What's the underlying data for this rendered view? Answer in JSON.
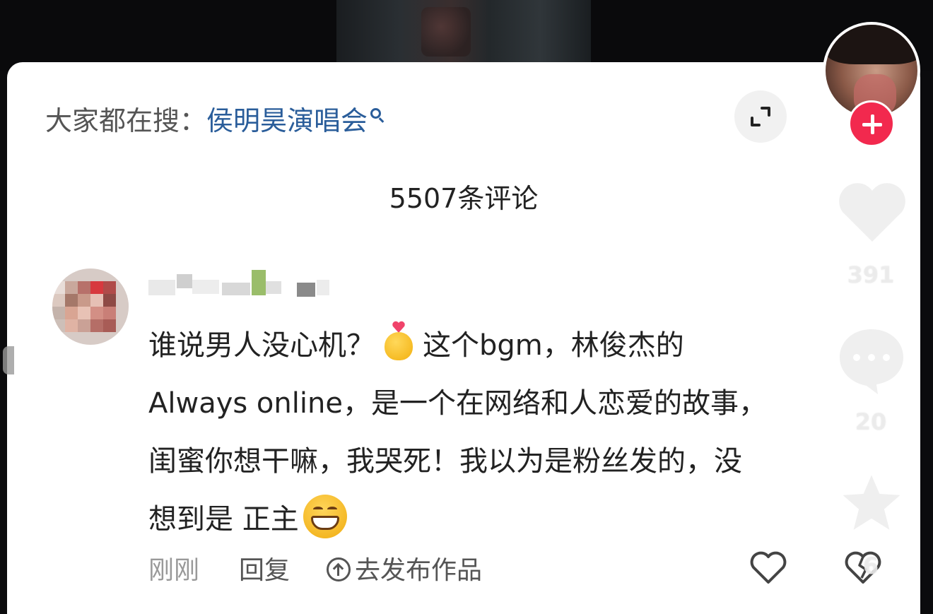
{
  "search_bar": {
    "prefix": "大家都在搜：",
    "keyword": "侯明昊演唱会",
    "icon": "search-icon"
  },
  "comments_header": {
    "count_label": "5507条评论"
  },
  "comment": {
    "text_before_emoji": "谁说男人没心机？",
    "emoji_1": "finger-heart-emoji",
    "text_line_1_rest": "这个bgm，林俊杰的",
    "text_line_2": "Always online，是一个在网络和人恋爱的故事，",
    "text_line_3": "闺蜜你想干嘛，我哭死！我以为是粉丝发的，没",
    "text_line_4": "想到是 正主",
    "emoji_2": "grinning-face-emoji",
    "time": "刚刚",
    "reply_label": "回复",
    "publish_label": "去发布作品"
  },
  "side_actions": {
    "like_count": "391",
    "comment_count": "20",
    "dislike_count": "6"
  },
  "colors": {
    "keyword": "#2a5d9a",
    "follow_button": "#f2294e",
    "panel_background": "#ffffff"
  }
}
